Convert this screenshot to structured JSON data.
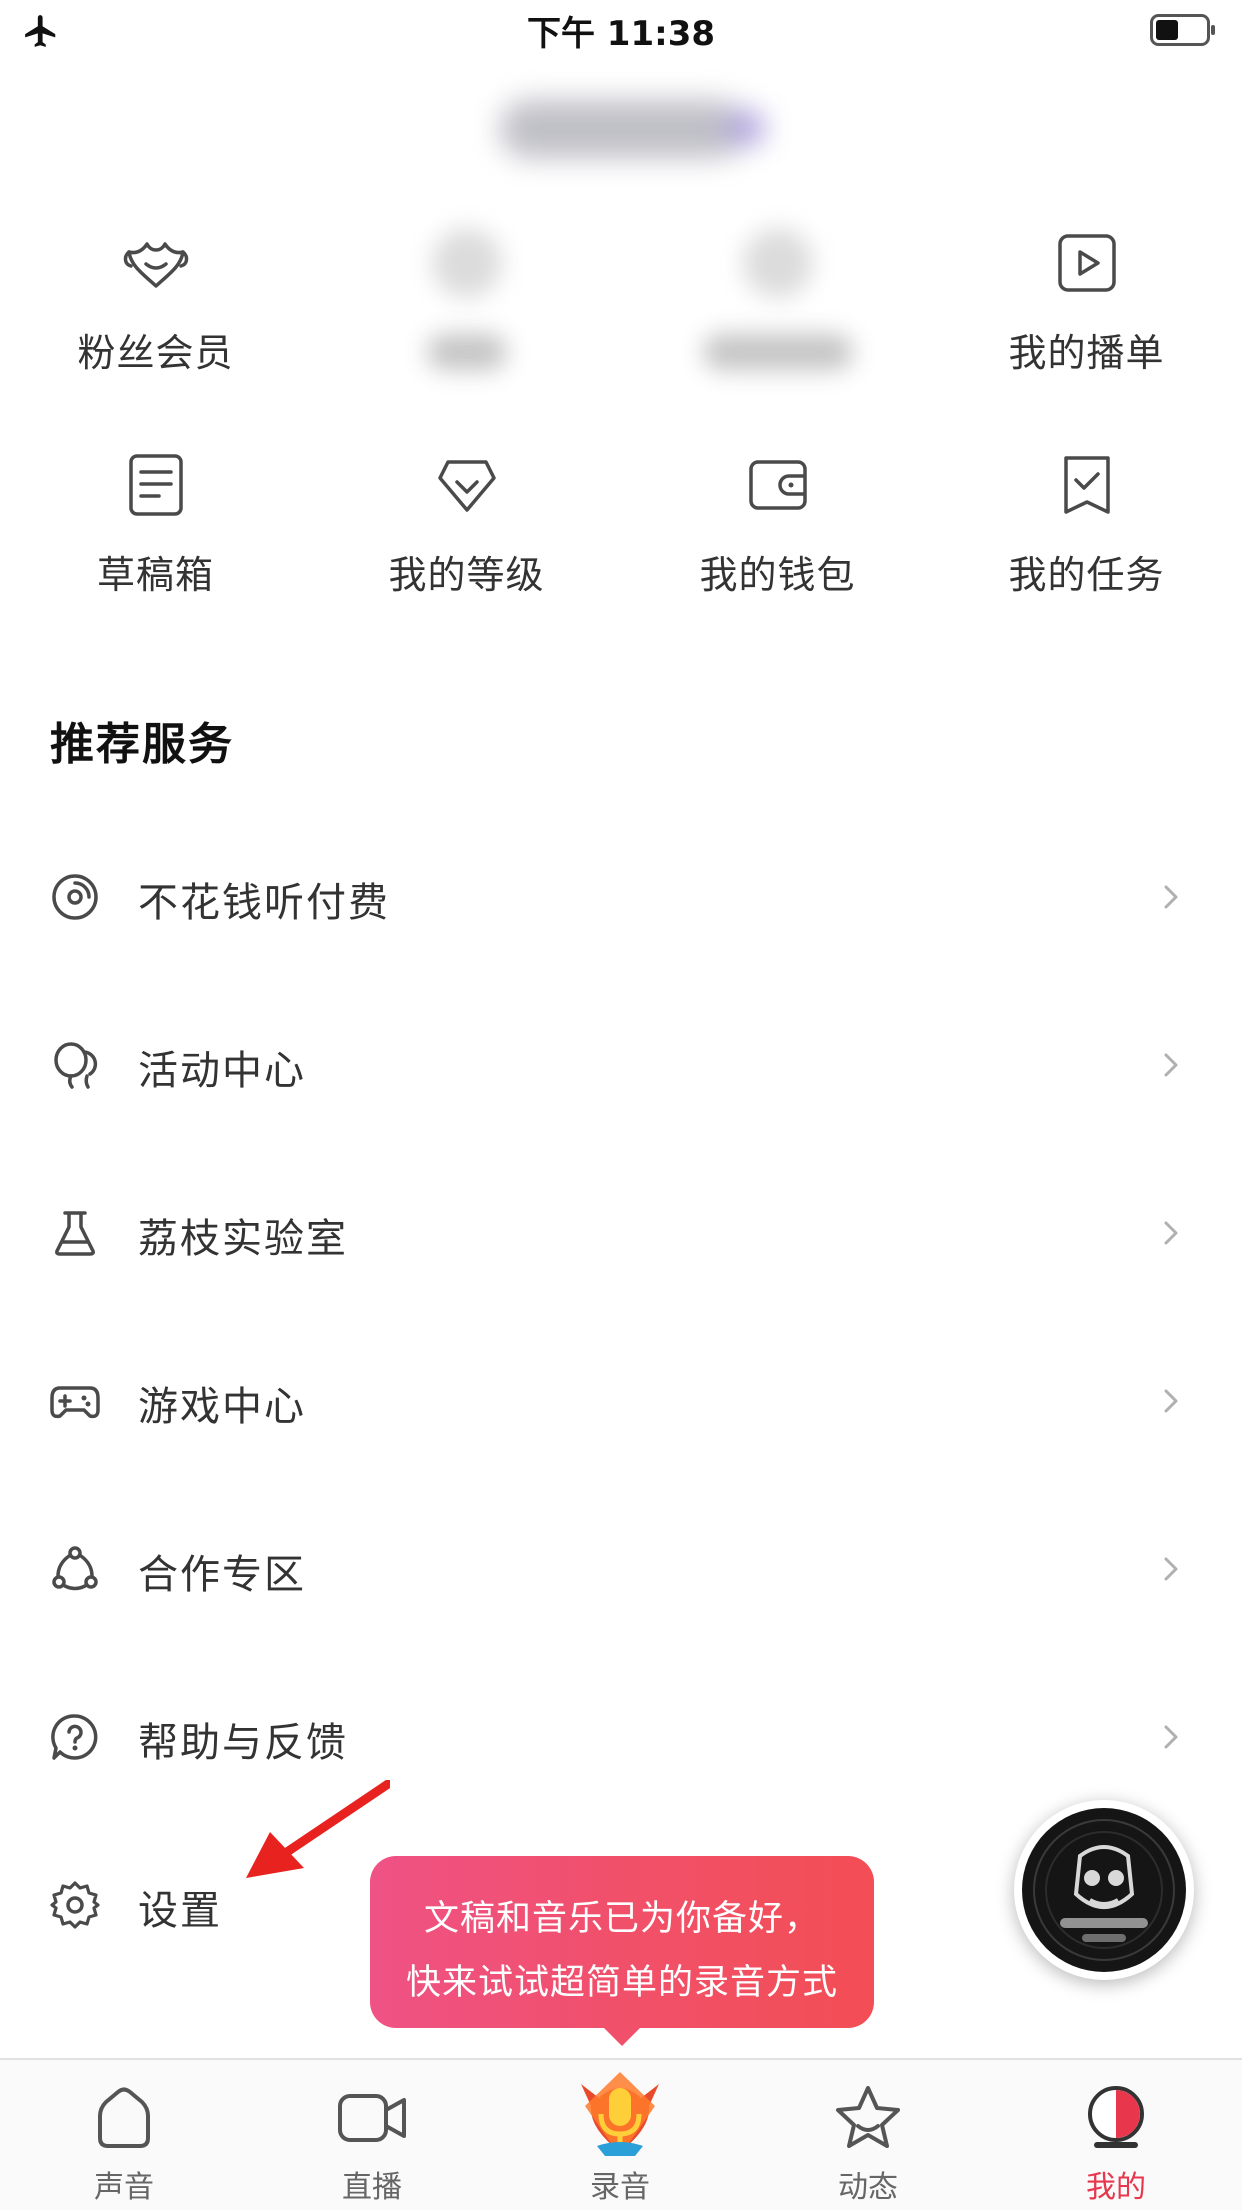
{
  "status_bar": {
    "time": "下午 11:38"
  },
  "quick_grid": {
    "row1": [
      {
        "label": "粉丝会员",
        "icon": "fan-member-icon"
      },
      {
        "label": "",
        "icon": "blurred-icon"
      },
      {
        "label": "",
        "icon": "blurred-icon"
      },
      {
        "label": "我的播单",
        "icon": "playlist-icon"
      }
    ],
    "row2": [
      {
        "label": "草稿箱",
        "icon": "draft-icon"
      },
      {
        "label": "我的等级",
        "icon": "level-icon"
      },
      {
        "label": "我的钱包",
        "icon": "wallet-icon"
      },
      {
        "label": "我的任务",
        "icon": "task-icon"
      }
    ]
  },
  "section_title": "推荐服务",
  "services": [
    {
      "label": "不花钱听付费",
      "icon": "disc-icon"
    },
    {
      "label": "活动中心",
      "icon": "balloon-icon"
    },
    {
      "label": "荔枝实验室",
      "icon": "flask-icon"
    },
    {
      "label": "游戏中心",
      "icon": "gamepad-icon"
    },
    {
      "label": "合作专区",
      "icon": "cooperation-icon"
    },
    {
      "label": "帮助与反馈",
      "icon": "help-icon"
    },
    {
      "label": "设置",
      "icon": "gear-icon"
    }
  ],
  "tooltip": {
    "line1": "文稿和音乐已为你备好，",
    "line2": "快来试试超简单的录音方式"
  },
  "tab_bar": {
    "tabs": [
      {
        "label": "声音",
        "icon": "home-icon"
      },
      {
        "label": "直播",
        "icon": "video-camera-icon"
      },
      {
        "label": "录音",
        "icon": "microphone-icon"
      },
      {
        "label": "动态",
        "icon": "star-icon"
      },
      {
        "label": "我的",
        "icon": "profile-icon"
      }
    ],
    "active": "我的"
  },
  "colors": {
    "accent_red": "#e8374c",
    "tooltip_pink": "#ef5285",
    "tooltip_red": "#f34e55",
    "icon_gray": "#4a4a4a",
    "text_dark": "#333333"
  }
}
